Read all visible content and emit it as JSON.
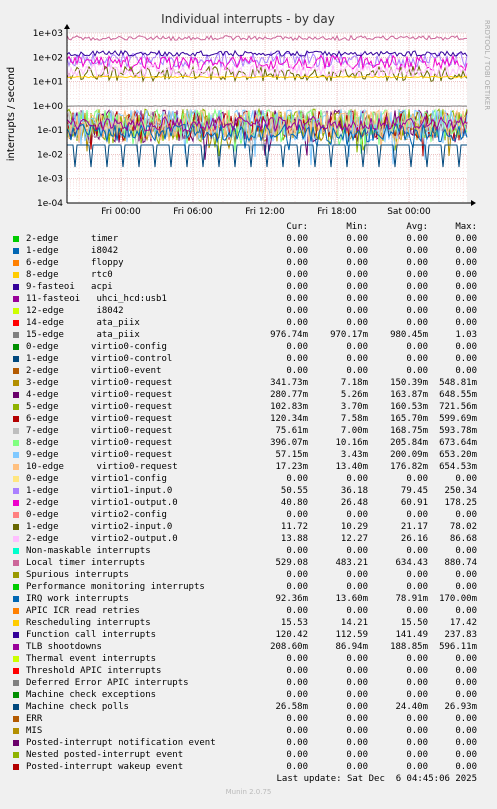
{
  "chart_data": {
    "type": "line",
    "title": "Individual interrupts - by day",
    "ylabel": "interrupts / second",
    "yscale": "log",
    "ylim": [
      0.0001,
      1000
    ],
    "yticks": [
      "1e-04",
      "1e-03",
      "1e-02",
      "1e-01",
      "1e+00",
      "1e+01",
      "1e+02",
      "1e+03"
    ],
    "xlabels": [
      "Fri 00:00",
      "Fri 06:00",
      "Fri 12:00",
      "Fri 18:00",
      "Sat 00:00"
    ],
    "grid": true,
    "side_label": "RRDTOOL / TOBI OETIKER",
    "columns": [
      "Cur:",
      "Min:",
      "Avg:",
      "Max:"
    ],
    "series": [
      {
        "name": "2-edge      timer",
        "color": "#00cc00",
        "cur": "0.00",
        "min": "0.00",
        "avg": "0.00",
        "max": "0.00"
      },
      {
        "name": "1-edge      i8042",
        "color": "#0066b3",
        "cur": "0.00",
        "min": "0.00",
        "avg": "0.00",
        "max": "0.00"
      },
      {
        "name": "6-edge      floppy",
        "color": "#ff8000",
        "cur": "0.00",
        "min": "0.00",
        "avg": "0.00",
        "max": "0.00"
      },
      {
        "name": "8-edge      rtc0",
        "color": "#ffcc00",
        "cur": "0.00",
        "min": "0.00",
        "avg": "0.00",
        "max": "0.00"
      },
      {
        "name": "9-fasteoi   acpi",
        "color": "#330099",
        "cur": "0.00",
        "min": "0.00",
        "avg": "0.00",
        "max": "0.00"
      },
      {
        "name": "11-fasteoi   uhci_hcd:usb1",
        "color": "#990099",
        "cur": "0.00",
        "min": "0.00",
        "avg": "0.00",
        "max": "0.00"
      },
      {
        "name": "12-edge      i8042",
        "color": "#ccff00",
        "cur": "0.00",
        "min": "0.00",
        "avg": "0.00",
        "max": "0.00"
      },
      {
        "name": "14-edge      ata_piix",
        "color": "#ff0000",
        "cur": "0.00",
        "min": "0.00",
        "avg": "0.00",
        "max": "0.00"
      },
      {
        "name": "15-edge      ata_piix",
        "color": "#808080",
        "cur": "976.74m",
        "min": "970.17m",
        "avg": "980.45m",
        "max": "1.03"
      },
      {
        "name": "0-edge      virtio0-config",
        "color": "#008f00",
        "cur": "0.00",
        "min": "0.00",
        "avg": "0.00",
        "max": "0.00"
      },
      {
        "name": "1-edge      virtio0-control",
        "color": "#00487d",
        "cur": "0.00",
        "min": "0.00",
        "avg": "0.00",
        "max": "0.00"
      },
      {
        "name": "2-edge      virtio0-event",
        "color": "#b35a00",
        "cur": "0.00",
        "min": "0.00",
        "avg": "0.00",
        "max": "0.00"
      },
      {
        "name": "3-edge      virtio0-request",
        "color": "#b38f00",
        "cur": "341.73m",
        "min": "7.18m",
        "avg": "150.39m",
        "max": "548.81m"
      },
      {
        "name": "4-edge      virtio0-request",
        "color": "#6b006b",
        "cur": "280.77m",
        "min": "5.26m",
        "avg": "163.87m",
        "max": "648.55m"
      },
      {
        "name": "5-edge      virtio0-request",
        "color": "#8fb300",
        "cur": "102.83m",
        "min": "3.70m",
        "avg": "160.53m",
        "max": "721.56m"
      },
      {
        "name": "6-edge      virtio0-request",
        "color": "#b30000",
        "cur": "120.34m",
        "min": "7.58m",
        "avg": "165.70m",
        "max": "599.69m"
      },
      {
        "name": "7-edge      virtio0-request",
        "color": "#bebebe",
        "cur": "75.61m",
        "min": "7.00m",
        "avg": "168.75m",
        "max": "593.78m"
      },
      {
        "name": "8-edge      virtio0-request",
        "color": "#80ff80",
        "cur": "396.07m",
        "min": "10.16m",
        "avg": "205.84m",
        "max": "673.64m"
      },
      {
        "name": "9-edge      virtio0-request",
        "color": "#80c9ff",
        "cur": "57.15m",
        "min": "3.43m",
        "avg": "200.09m",
        "max": "653.20m"
      },
      {
        "name": "10-edge      virtio0-request",
        "color": "#ffc080",
        "cur": "17.23m",
        "min": "13.40m",
        "avg": "176.82m",
        "max": "654.53m"
      },
      {
        "name": "0-edge      virtio1-config",
        "color": "#ffe680",
        "cur": "0.00",
        "min": "0.00",
        "avg": "0.00",
        "max": "0.00"
      },
      {
        "name": "1-edge      virtio1-input.0",
        "color": "#aa80ff",
        "cur": "50.55",
        "min": "36.18",
        "avg": "79.45",
        "max": "250.34"
      },
      {
        "name": "2-edge      virtio1-output.0",
        "color": "#ee00cc",
        "cur": "40.80",
        "min": "26.48",
        "avg": "60.91",
        "max": "178.25"
      },
      {
        "name": "0-edge      virtio2-config",
        "color": "#ff8080",
        "cur": "0.00",
        "min": "0.00",
        "avg": "0.00",
        "max": "0.00"
      },
      {
        "name": "1-edge      virtio2-input.0",
        "color": "#666600",
        "cur": "11.72",
        "min": "10.29",
        "avg": "21.17",
        "max": "78.02"
      },
      {
        "name": "2-edge      virtio2-output.0",
        "color": "#ffbfff",
        "cur": "13.88",
        "min": "12.27",
        "avg": "26.16",
        "max": "86.68"
      },
      {
        "name": "Non-maskable interrupts",
        "color": "#00ffcc",
        "cur": "0.00",
        "min": "0.00",
        "avg": "0.00",
        "max": "0.00"
      },
      {
        "name": "Local timer interrupts",
        "color": "#cc6699",
        "cur": "529.08",
        "min": "483.21",
        "avg": "634.43",
        "max": "880.74"
      },
      {
        "name": "Spurious interrupts",
        "color": "#999900",
        "cur": "0.00",
        "min": "0.00",
        "avg": "0.00",
        "max": "0.00"
      },
      {
        "name": "Performance monitoring interrupts",
        "color": "#00cc00",
        "cur": "0.00",
        "min": "0.00",
        "avg": "0.00",
        "max": "0.00"
      },
      {
        "name": "IRQ work interrupts",
        "color": "#0066b3",
        "cur": "92.36m",
        "min": "13.60m",
        "avg": "78.91m",
        "max": "170.00m"
      },
      {
        "name": "APIC ICR read retries",
        "color": "#ff8000",
        "cur": "0.00",
        "min": "0.00",
        "avg": "0.00",
        "max": "0.00"
      },
      {
        "name": "Rescheduling interrupts",
        "color": "#ffcc00",
        "cur": "15.53",
        "min": "14.21",
        "avg": "15.50",
        "max": "17.42"
      },
      {
        "name": "Function call interrupts",
        "color": "#330099",
        "cur": "120.42",
        "min": "112.59",
        "avg": "141.49",
        "max": "237.83"
      },
      {
        "name": "TLB shootdowns",
        "color": "#990099",
        "cur": "208.60m",
        "min": "86.94m",
        "avg": "188.85m",
        "max": "596.11m"
      },
      {
        "name": "Thermal event interrupts",
        "color": "#ccff00",
        "cur": "0.00",
        "min": "0.00",
        "avg": "0.00",
        "max": "0.00"
      },
      {
        "name": "Threshold APIC interrupts",
        "color": "#ff0000",
        "cur": "0.00",
        "min": "0.00",
        "avg": "0.00",
        "max": "0.00"
      },
      {
        "name": "Deferred Error APIC interrupts",
        "color": "#808080",
        "cur": "0.00",
        "min": "0.00",
        "avg": "0.00",
        "max": "0.00"
      },
      {
        "name": "Machine check exceptions",
        "color": "#008f00",
        "cur": "0.00",
        "min": "0.00",
        "avg": "0.00",
        "max": "0.00"
      },
      {
        "name": "Machine check polls",
        "color": "#00487d",
        "cur": "26.58m",
        "min": "0.00",
        "avg": "24.40m",
        "max": "26.93m"
      },
      {
        "name": "ERR",
        "color": "#b35a00",
        "cur": "0.00",
        "min": "0.00",
        "avg": "0.00",
        "max": "0.00"
      },
      {
        "name": "MIS",
        "color": "#b38f00",
        "cur": "0.00",
        "min": "0.00",
        "avg": "0.00",
        "max": "0.00"
      },
      {
        "name": "Posted-interrupt notification event",
        "color": "#6b006b",
        "cur": "0.00",
        "min": "0.00",
        "avg": "0.00",
        "max": "0.00"
      },
      {
        "name": "Nested posted-interrupt event",
        "color": "#8fb300",
        "cur": "0.00",
        "min": "0.00",
        "avg": "0.00",
        "max": "0.00"
      },
      {
        "name": "Posted-interrupt wakeup event",
        "color": "#b30000",
        "cur": "0.00",
        "min": "0.00",
        "avg": "0.00",
        "max": "0.00"
      }
    ]
  },
  "last_update": "Last update: Sat Dec  6 04:45:06 2025",
  "footer": "Munin 2.0.75"
}
